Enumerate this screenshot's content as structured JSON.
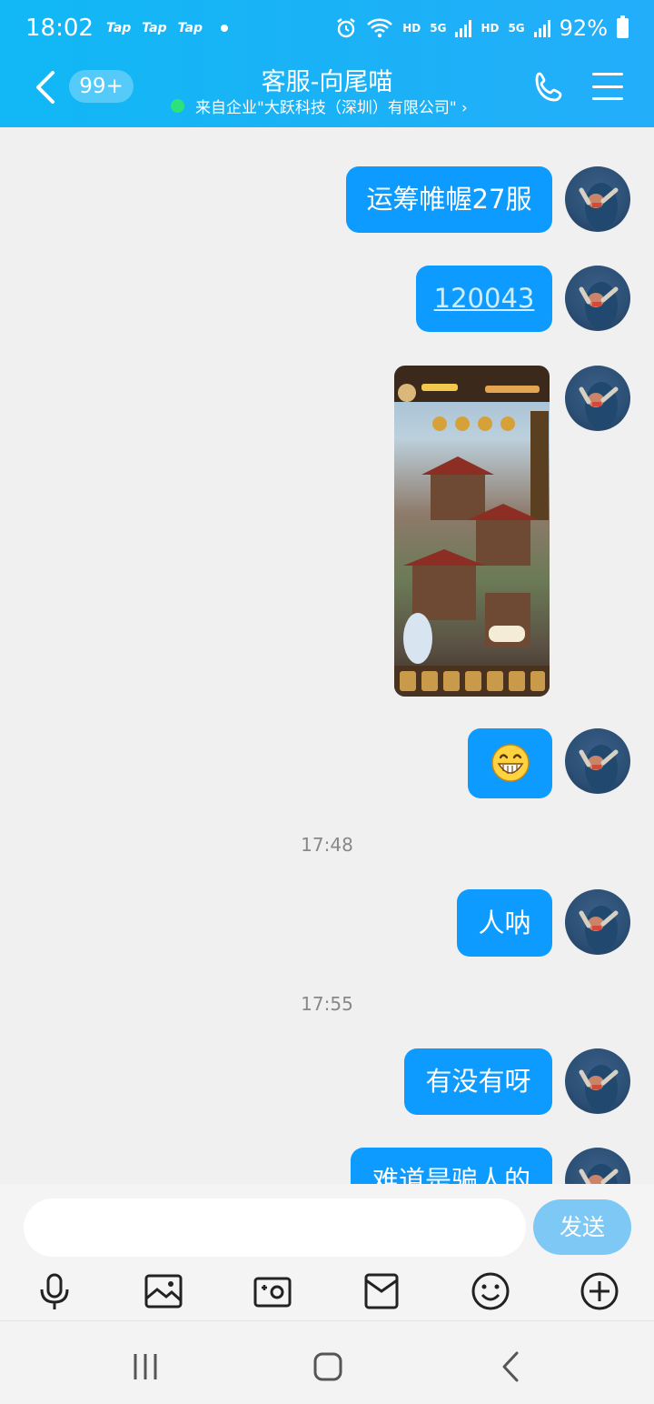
{
  "status_bar": {
    "time": "18:02",
    "tap_labels": [
      "Tap",
      "Tap",
      "Tap"
    ],
    "hd1": "HD",
    "net1": "5G",
    "hd2": "HD",
    "net2": "5G",
    "battery": "92%"
  },
  "header": {
    "badge": "99+",
    "title": "客服-向尾喵",
    "subtitle": "来自企业\"大跃科技（深圳）有限公司\" ›",
    "colors": {
      "bar": "#1ab2f6",
      "online": "#2ee27a"
    }
  },
  "chat": {
    "bubble_color": "#0d9bff",
    "messages": [
      {
        "type": "text",
        "text": "运筹帷幄27服"
      },
      {
        "type": "link",
        "text": "120043"
      },
      {
        "type": "image",
        "description_icon": "game-screenshot"
      },
      {
        "type": "emoji",
        "icon": "grin-emoji"
      },
      {
        "type": "time",
        "text": "17:48"
      },
      {
        "type": "text",
        "text": "人呐"
      },
      {
        "type": "time",
        "text": "17:55"
      },
      {
        "type": "text",
        "text": "有没有呀"
      },
      {
        "type": "text",
        "text": "难道是骗人的"
      }
    ]
  },
  "input": {
    "placeholder": "",
    "send_label": "发送",
    "tools": [
      "microphone-icon",
      "image-icon",
      "camera-icon",
      "red-packet-icon",
      "emoji-icon",
      "plus-icon"
    ]
  },
  "navbar": {
    "items": [
      "recents-icon",
      "home-icon",
      "back-icon"
    ]
  }
}
